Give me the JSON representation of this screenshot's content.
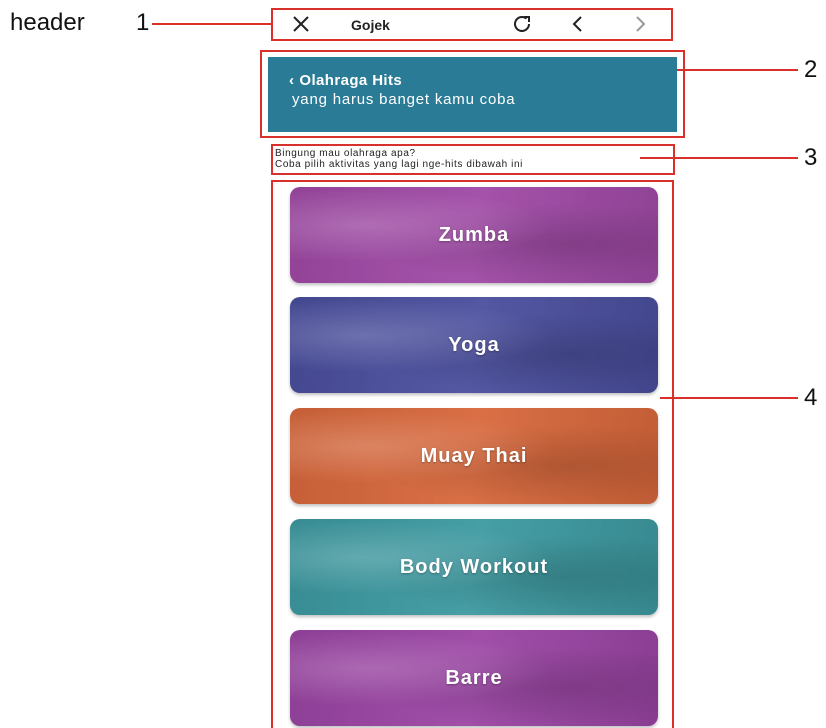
{
  "annotations": {
    "header_label": "header",
    "n1": "1",
    "n2": "2",
    "n3": "3",
    "n4": "4"
  },
  "header": {
    "title": "Gojek",
    "close_icon": "close-icon",
    "refresh_icon": "refresh-icon",
    "back_icon": "chevron-left-icon",
    "forward_icon": "chevron-right-icon"
  },
  "banner": {
    "title": "Olahraga Hits",
    "subtitle": "yang harus banget kamu coba",
    "color": "#2a7b96"
  },
  "intro": {
    "line1": "Bingung mau olahraga apa?",
    "line2": "Coba pilih aktivitas yang lagi nge-hits dibawah ini"
  },
  "activities": [
    {
      "label": "Zumba",
      "color": "#a04aa6"
    },
    {
      "label": "Yoga",
      "color": "#4b4f9e"
    },
    {
      "label": "Muay Thai",
      "color": "#d8683c"
    },
    {
      "label": "Body Workout",
      "color": "#3d9aa1"
    },
    {
      "label": "Barre",
      "color": "#9b45a4"
    }
  ]
}
